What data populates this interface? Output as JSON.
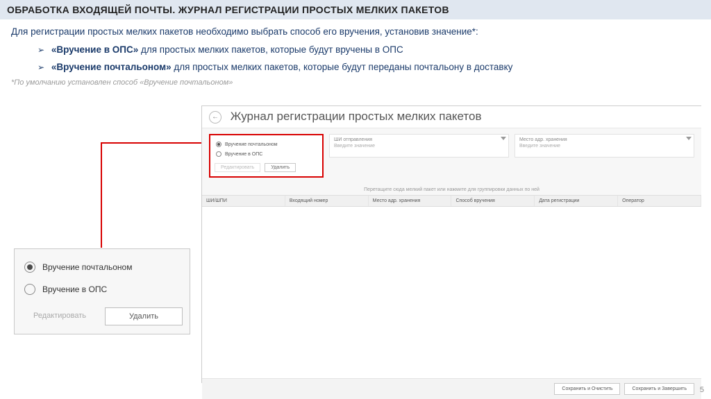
{
  "title": "ОБРАБОТКА ВХОДЯЩЕЙ ПОЧТЫ. ЖУРНАЛ РЕГИСТРАЦИИ ПРОСТЫХ МЕЛКИХ ПАКЕТОВ",
  "intro": "Для регистрации простых мелких пакетов необходимо выбрать способ его вручения, установив значение*:",
  "bullets": [
    {
      "strong": "«Вручение в ОПС»",
      "rest": " для простых мелких пакетов, которые будут вручены в ОПС"
    },
    {
      "strong": "«Вручение почтальоном»",
      "rest": " для простых мелких пакетов, которые будут переданы почтальону в доставку"
    }
  ],
  "footnote": "*По умолчанию установлен способ «Вручение почтальоном»",
  "app": {
    "title": "Журнал регистрации простых мелких пакетов",
    "radio_panel": {
      "opt1": "Вручение почтальоном",
      "opt2": "Вручение в ОПС",
      "edit": "Редактировать",
      "delete": "Удалить"
    },
    "fields": {
      "f1_label": "ШИ отправления",
      "f1_value": "Введите значение",
      "f2_label": "Место адр. хранения",
      "f2_value": "Введите значение"
    },
    "hint": "Перетащите сюда мелкий пакет или нажмите для группировки данных по ней",
    "columns": {
      "c1": "ШИ/ШПИ",
      "c2": "Входящий номер",
      "c3": "Место адр. хранения",
      "c4": "Способ вручения",
      "c5": "Дата регистрации",
      "c6": "Оператор"
    },
    "buttons": {
      "b1": "Сохранить и Очистить",
      "b2": "Сохранить и Завершить"
    }
  },
  "callout": {
    "opt1": "Вручение почтальоном",
    "opt2": "Вручение в ОПС",
    "edit": "Редактировать",
    "delete": "Удалить"
  },
  "page_number": "5"
}
